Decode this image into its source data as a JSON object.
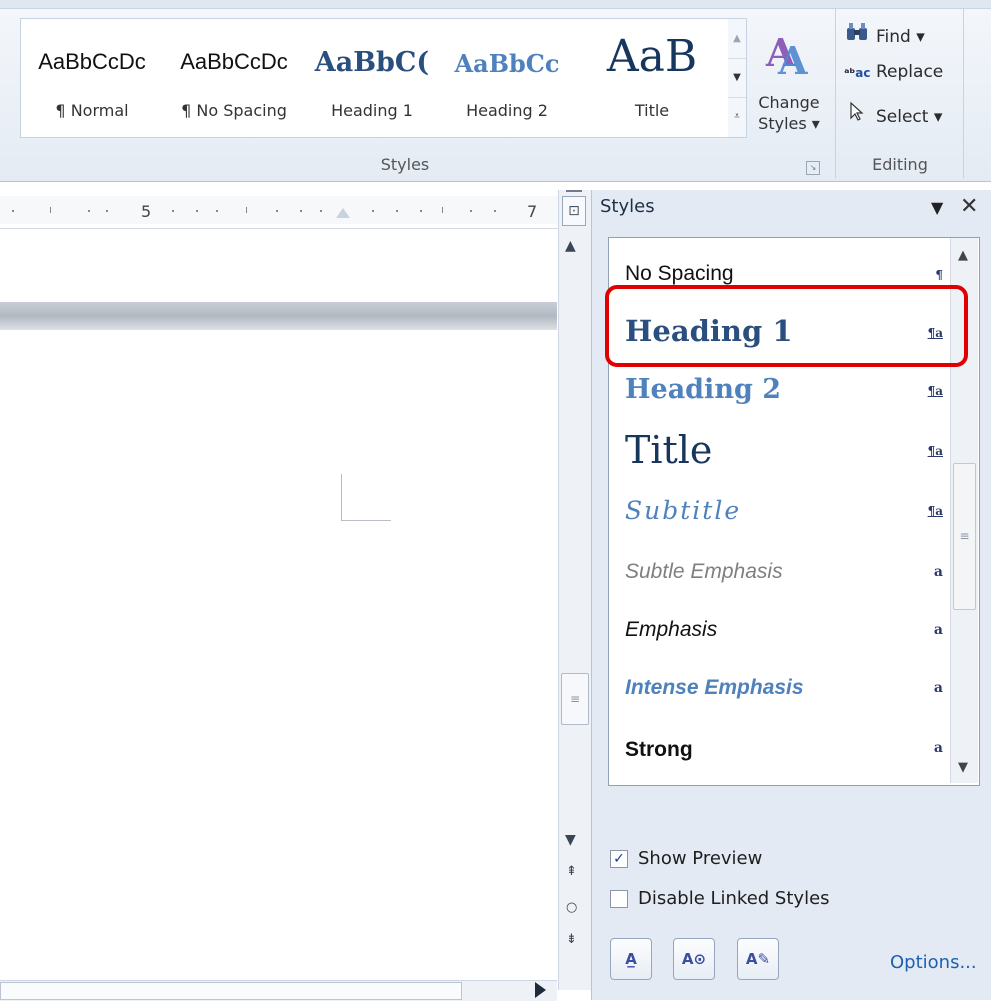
{
  "ribbon": {
    "style_gallery": [
      {
        "preview": "AaBbCcDc",
        "label": "¶ Normal"
      },
      {
        "preview": "AaBbCcDc",
        "label": "¶ No Spacing"
      },
      {
        "preview": "AaBbC(",
        "label": "Heading 1"
      },
      {
        "preview": "AaBbCc",
        "label": "Heading 2"
      },
      {
        "preview": "AaB",
        "label": "Title"
      }
    ],
    "change_styles_label_1": "Change",
    "change_styles_label_2": "Styles ▾",
    "styles_group_label": "Styles",
    "editing": {
      "find": "Find ▾",
      "replace": "Replace",
      "select": "Select ▾",
      "group_label": "Editing"
    }
  },
  "ruler": {
    "numbers": [
      "5",
      "7"
    ]
  },
  "styles_pane": {
    "title": "Styles",
    "items": [
      {
        "name": "No Spacing",
        "mark": "¶"
      },
      {
        "name": "Heading 1",
        "mark": "¶a"
      },
      {
        "name": "Heading 2",
        "mark": "¶a"
      },
      {
        "name": "Title",
        "mark": "¶a"
      },
      {
        "name": "Subtitle",
        "mark": "¶a"
      },
      {
        "name": "Subtle Emphasis",
        "mark": "a"
      },
      {
        "name": "Emphasis",
        "mark": "a"
      },
      {
        "name": "Intense Emphasis",
        "mark": "a"
      },
      {
        "name": "Strong",
        "mark": "a"
      }
    ],
    "show_preview_label": "Show Preview",
    "show_preview_checked": true,
    "disable_linked_label": "Disable Linked Styles",
    "disable_linked_checked": false,
    "options_label": "Options...",
    "highlight_color": "#e00000",
    "heading_color": "#2a4f7f",
    "accent_color": "#4f81bd"
  }
}
